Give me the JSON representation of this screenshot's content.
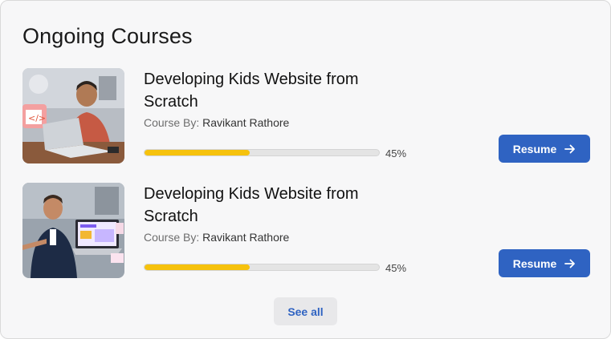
{
  "section": {
    "title": "Ongoing Courses"
  },
  "courses": [
    {
      "title": "Developing Kids Website from Scratch",
      "byline_prefix": "Course By:",
      "author": "Ravikant Rathore",
      "progress_percent": 45,
      "progress_label": "45%",
      "resume_label": "Resume",
      "thumbnail": "person-with-laptop-photo"
    },
    {
      "title": "Developing Kids Website from Scratch",
      "byline_prefix": "Course By:",
      "author": "Ravikant Rathore",
      "progress_percent": 45,
      "progress_label": "45%",
      "resume_label": "Resume",
      "thumbnail": "presenter-with-laptop-photo"
    }
  ],
  "footer": {
    "see_all_label": "See all"
  },
  "colors": {
    "accent": "#2f63c2",
    "progress": "#f6c20d",
    "track": "#e4e4e4"
  }
}
